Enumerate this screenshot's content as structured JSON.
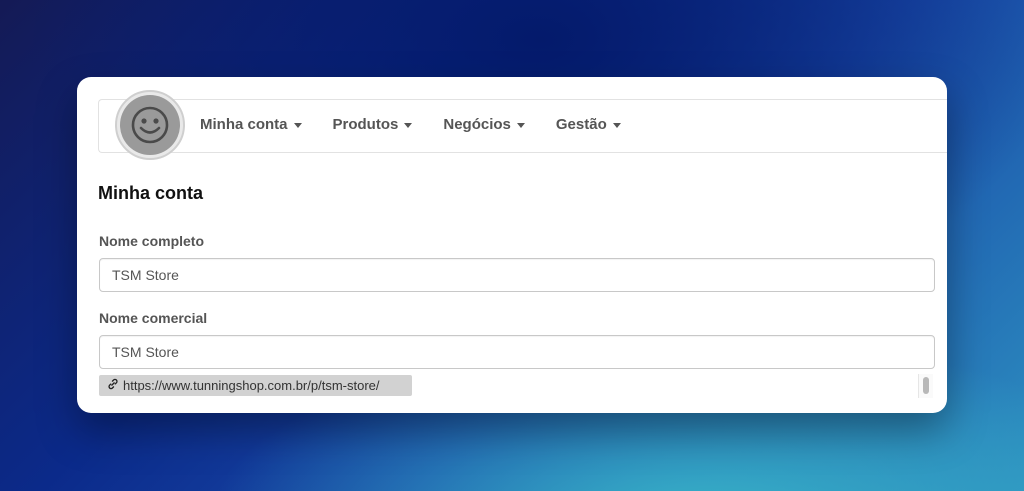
{
  "nav": {
    "items": [
      {
        "label": "Minha conta"
      },
      {
        "label": "Produtos"
      },
      {
        "label": "Negócios"
      },
      {
        "label": "Gestão"
      }
    ]
  },
  "page": {
    "title": "Minha conta"
  },
  "form": {
    "full_name": {
      "label": "Nome completo",
      "value": "TSM Store"
    },
    "trade_name": {
      "label": "Nome comercial",
      "value": "TSM Store"
    },
    "store_url": "https://www.tunningshop.com.br/p/tsm-store/"
  },
  "icons": {
    "avatar": "smiley-face-icon",
    "link": "link-icon",
    "caret": "caret-down-icon"
  }
}
